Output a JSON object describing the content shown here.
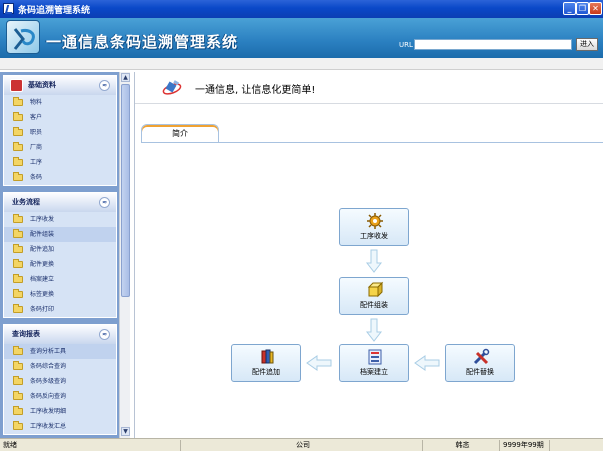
{
  "window": {
    "title": "条码追溯管理系统",
    "buttons": {
      "minimize": "_",
      "restore": "❐",
      "close": "✕"
    }
  },
  "banner": {
    "system_title": "一通信息条码追溯管理系统",
    "url_label": "URL",
    "url_value": "",
    "go_label": "进入"
  },
  "sidebar": {
    "panels": [
      {
        "title": "基础资料",
        "collapse": "≈",
        "items": [
          "物料",
          "客户",
          "职员",
          "厂商",
          "工序",
          "条码"
        ]
      },
      {
        "title": "业务流程",
        "collapse": "≈",
        "items": [
          "工序收发",
          "配件组装",
          "配件追加",
          "配件更换",
          "档案建立",
          "标签更换",
          "条码打印"
        ]
      },
      {
        "title": "查询报表",
        "collapse": "≈",
        "items": [
          "查询分析工具",
          "条码综合查询",
          "条码多级查询",
          "条码反向查询",
          "工序收发明细",
          "工序收发汇总"
        ]
      }
    ]
  },
  "main": {
    "slogan": "一通信息, 让信息化更简单!",
    "tab_label": "简介",
    "flow": {
      "process_transfer": "工序收发",
      "part_assembly": "配件组装",
      "archive_create": "档案建立",
      "part_add": "配件追加",
      "part_replace": "配件替换"
    }
  },
  "status_bar": {
    "ready": "就绪",
    "company": "公司",
    "user": "韩忞",
    "period": "9999年99期"
  },
  "colors": {
    "title_bar": "#0a48c8",
    "banner": "#2a7fc0",
    "sidebar_bg": "#7e9fcf",
    "panel_bg": "#d6e3f5",
    "tab_accent": "#f0a232"
  }
}
